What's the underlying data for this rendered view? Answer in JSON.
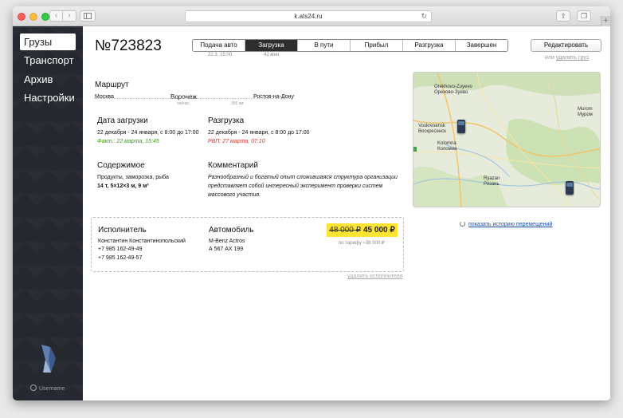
{
  "browser": {
    "url": "k.ats24.ru",
    "back_glyph": "‹",
    "forward_glyph": "›",
    "reload_glyph": "↻",
    "share_glyph": "⇧",
    "tabs_glyph": "❐",
    "newtab_glyph": "+"
  },
  "sidebar": {
    "items": [
      {
        "label": "Грузы"
      },
      {
        "label": "Транспорт"
      },
      {
        "label": "Архив"
      },
      {
        "label": "Настройки"
      }
    ],
    "username": "Username",
    "logo_icon": "penguin-logo-icon"
  },
  "order": {
    "title": "№723823",
    "steps": [
      {
        "label": "Подача авто",
        "time": "22.3, 15:00"
      },
      {
        "label": "Загрузка",
        "time": "42 мин"
      },
      {
        "label": "В пути"
      },
      {
        "label": "Прибыл"
      },
      {
        "label": "Разгрузка"
      },
      {
        "label": "Завершен"
      }
    ],
    "active_step": "Загрузка",
    "edit_label": "Редактировать",
    "or_text": "или",
    "delete_label": "удалить груз"
  },
  "route": {
    "heading": "Маршрут",
    "from": "Москва",
    "current": "Воронеж",
    "current_sub": "сейчас",
    "distance": "355 км",
    "to": "Ростов-на-Дону"
  },
  "loading": {
    "heading": "Дата загрузки",
    "dates": "22 декабря - 24 января, с 8:00 до 17:00",
    "fact": "Факт.: 22 марта, 15:45"
  },
  "unloading": {
    "heading": "Разгрузка",
    "dates": "22 декабря - 24 января, с 8:00 до 17:00",
    "rvp": "РВП: 27 марта, 07:10"
  },
  "contents": {
    "heading": "Содержимое",
    "desc": "Продукты, заморозка, рыба",
    "size": "14 т, 5×12×3 м, 9 м³"
  },
  "comment": {
    "heading": "Комментарий",
    "line1": "Разнообразный и богатый опыт сложившаяся структура организации",
    "line2": "представляет собой интересный эксперимент проверки систем",
    "line3": "массового участия."
  },
  "executor": {
    "heading": "Исполнитель",
    "name": "Константин Константинопольский",
    "phone1": "+7 985 162-49-49",
    "phone2": "+7 985 162-49-57"
  },
  "vehicle": {
    "heading": "Автомобиль",
    "model": "M-Benz Actros",
    "plate": "А 567 АХ 199"
  },
  "price": {
    "old": "48 000 ₽",
    "new": "45 000 ₽",
    "tariff": "по тарифу ≈38 000 ₽"
  },
  "remove_executor": "удалить исполнителя",
  "map": {
    "labels": [
      {
        "text": "Orekhovo-Zuyevo"
      },
      {
        "text": "Орехово-Зуево"
      },
      {
        "text": "Voskresensk"
      },
      {
        "text": "Воскресенск"
      },
      {
        "text": "Kolomna"
      },
      {
        "text": "Коломна"
      },
      {
        "text": "Ryazan"
      },
      {
        "text": "Рязань"
      },
      {
        "text": "Murom"
      },
      {
        "text": "Муром"
      }
    ]
  },
  "history_label": "показать историю перемещений"
}
